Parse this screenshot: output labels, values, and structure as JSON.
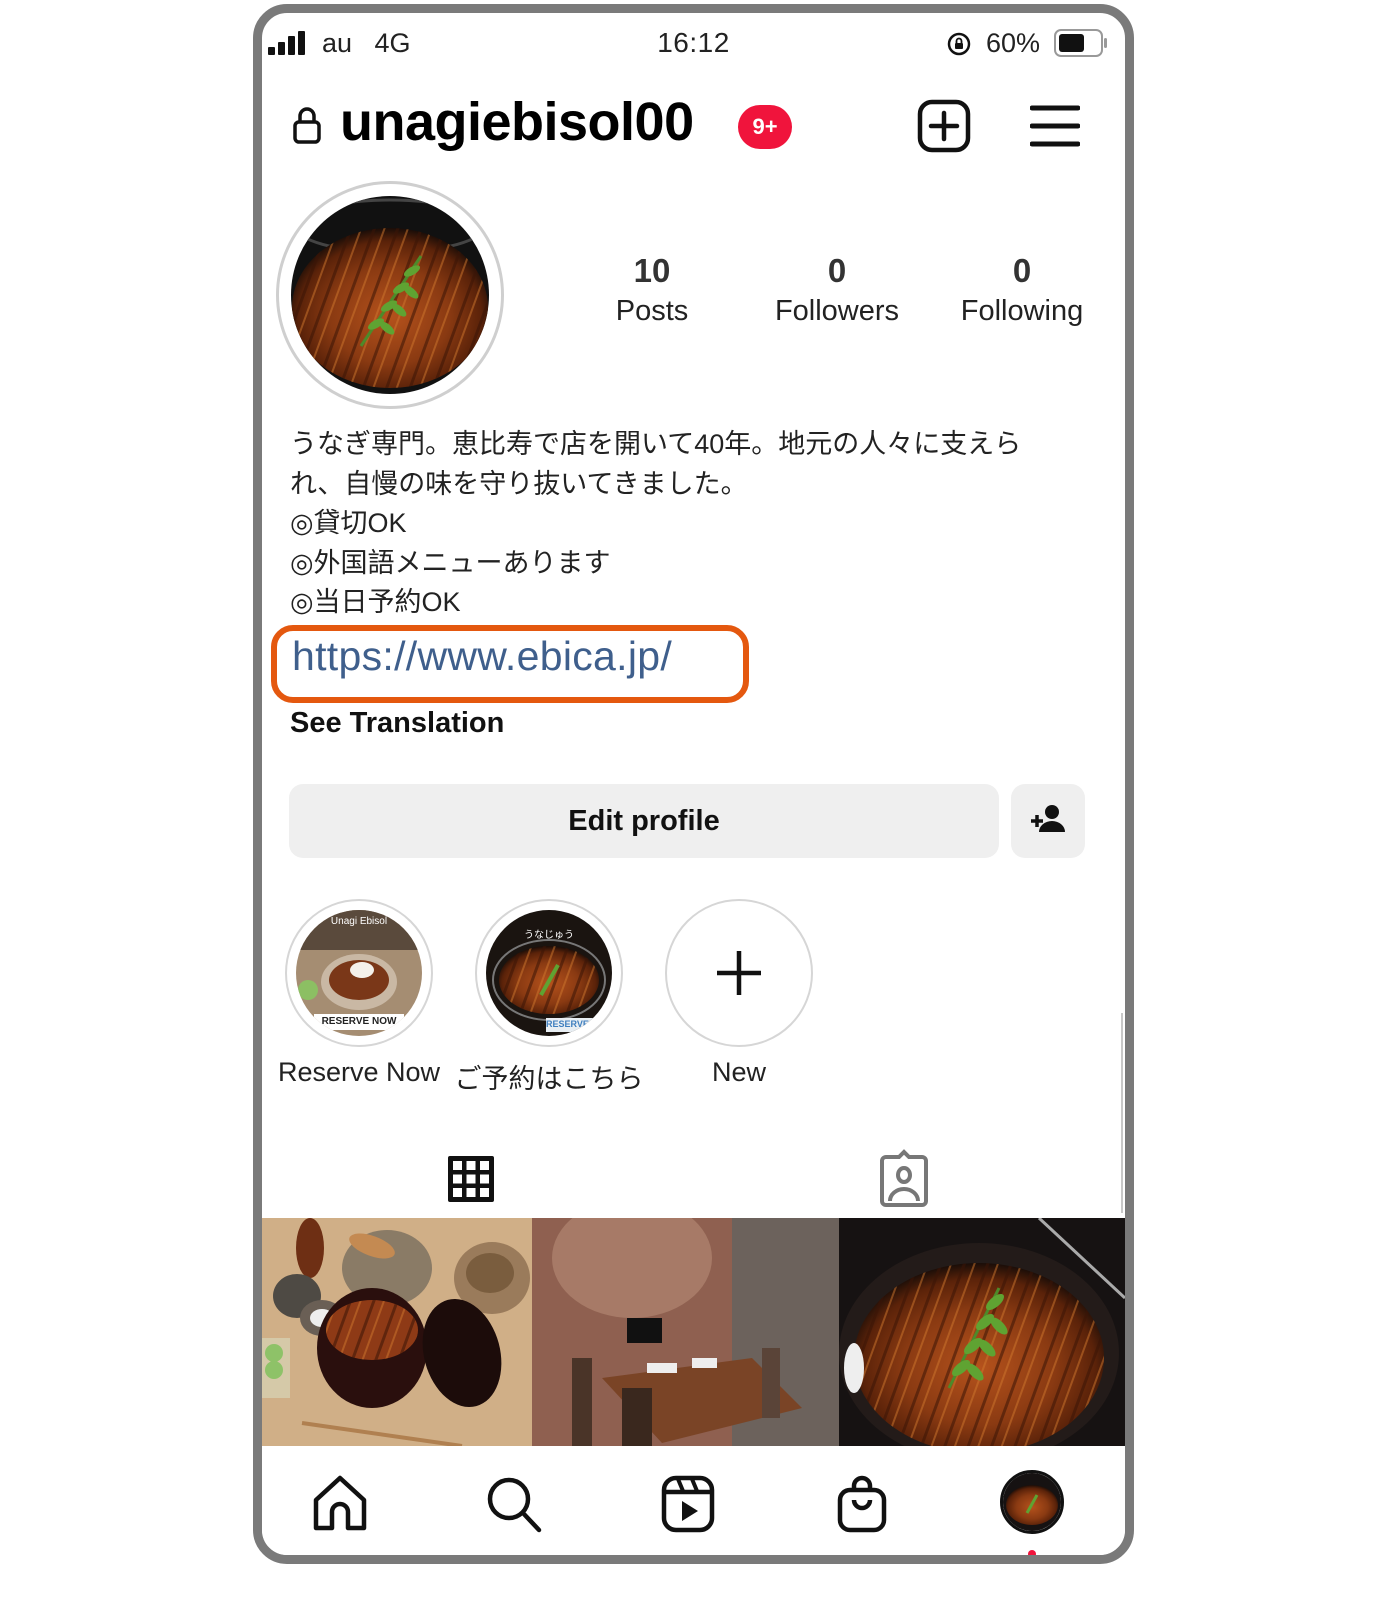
{
  "status_bar": {
    "carrier": "au   4G",
    "time": "16:12",
    "battery": "60%",
    "icons": [
      "signal-icon",
      "orientation-lock-icon",
      "battery-icon"
    ]
  },
  "header": {
    "username": "unagiebisol00",
    "notification_badge": "9+",
    "icons": [
      "lock-icon",
      "new-post-icon",
      "menu-icon"
    ],
    "badge_color": "#f0143c"
  },
  "profile": {
    "stats": [
      {
        "value": "10",
        "label": "Posts"
      },
      {
        "value": "0",
        "label": "Followers"
      },
      {
        "value": "0",
        "label": "Following"
      }
    ],
    "bio_lines": [
      "うなぎ専門。恵比寿で店を開いて40年。地元の人々に支えら",
      "れ、自慢の味を守り抜いてきました。",
      "◎貸切OK",
      "◎外国語メニューあります",
      "◎当日予約OK"
    ],
    "link": "https://www.ebica.jp/",
    "link_color": "#3f5f8c",
    "highlight_box_color": "#e4580f",
    "see_translation": "See Translation",
    "edit_profile": "Edit profile"
  },
  "highlights": [
    {
      "label": "Reserve Now",
      "cover_title": "Unagi Ebisol",
      "cover_sticker": "RESERVE NOW"
    },
    {
      "label": "ご予約はこちら",
      "cover_title": "うなじゅう",
      "cover_sticker": "RESERVE"
    },
    {
      "label": "New"
    }
  ],
  "tabs": [
    {
      "name": "posts-grid",
      "icon": "grid-icon",
      "active": true
    },
    {
      "name": "tagged",
      "icon": "tagged-person-icon",
      "active": false
    }
  ],
  "grid_posts": [
    {
      "subject": "unaju set with tea pot and sides"
    },
    {
      "subject": "private dining room"
    },
    {
      "subject": "unagi rice bowl close-up"
    }
  ],
  "bottom_nav": [
    {
      "name": "home",
      "icon": "home-icon"
    },
    {
      "name": "search",
      "icon": "search-icon"
    },
    {
      "name": "reels",
      "icon": "reels-icon"
    },
    {
      "name": "shop",
      "icon": "shopping-bag-icon"
    },
    {
      "name": "profile",
      "icon": "profile-avatar-icon",
      "active": true
    }
  ]
}
